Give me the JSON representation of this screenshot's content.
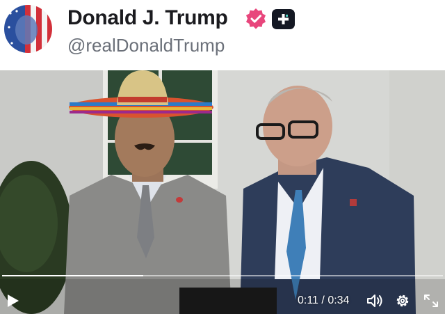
{
  "post": {
    "display_name": "Donald J. Trump",
    "handle": "@realDonaldTrump",
    "verified_icon": "verified-badge-icon",
    "badge_icon": "plus-badge-icon",
    "accent_color": "#e8467c"
  },
  "video": {
    "elapsed": "0:11",
    "separator": "/",
    "duration": "0:34",
    "progress": 0.32,
    "controls": [
      "play-icon",
      "volume-icon",
      "settings-gear-icon",
      "fullscreen-icon"
    ]
  }
}
